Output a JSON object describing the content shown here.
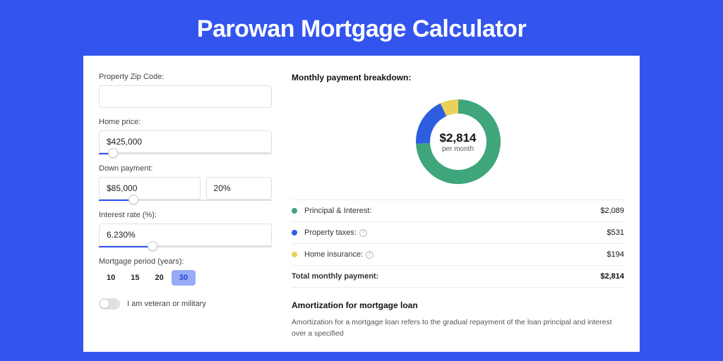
{
  "title": "Parowan Mortgage Calculator",
  "form": {
    "zip_label": "Property Zip Code:",
    "zip_value": "",
    "price_label": "Home price:",
    "price_value": "$425,000",
    "price_slider_pct": 8,
    "down_label": "Down payment:",
    "down_value": "$85,000",
    "down_pct": "20%",
    "down_slider_pct": 20,
    "rate_label": "Interest rate (%):",
    "rate_value": "6.230%",
    "rate_slider_pct": 31,
    "period_label": "Mortgage period (years):",
    "periods": [
      "10",
      "15",
      "20",
      "30"
    ],
    "period_active_index": 3,
    "veteran_label": "I am veteran or military"
  },
  "breakdown": {
    "title": "Monthly payment breakdown:",
    "donut_amount": "$2,814",
    "donut_sub": "per month",
    "items": [
      {
        "label": "Principal & Interest:",
        "value": "$2,089",
        "color": "#3fa57b",
        "info": false
      },
      {
        "label": "Property taxes:",
        "value": "$531",
        "color": "#2d5ee0",
        "info": true
      },
      {
        "label": "Home insurance:",
        "value": "$194",
        "color": "#ebd15a",
        "info": true
      }
    ],
    "total_label": "Total monthly payment:",
    "total_value": "$2,814"
  },
  "chart_data": {
    "type": "pie",
    "title": "Monthly payment breakdown",
    "series": [
      {
        "name": "Principal & Interest",
        "value": 2089,
        "color": "#3fa57b"
      },
      {
        "name": "Property taxes",
        "value": 531,
        "color": "#2d5ee0"
      },
      {
        "name": "Home insurance",
        "value": 194,
        "color": "#ebd15a"
      }
    ],
    "total": 2814
  },
  "amortization": {
    "title": "Amortization for mortgage loan",
    "text": "Amortization for a mortgage loan refers to the gradual repayment of the loan principal and interest over a specified"
  }
}
